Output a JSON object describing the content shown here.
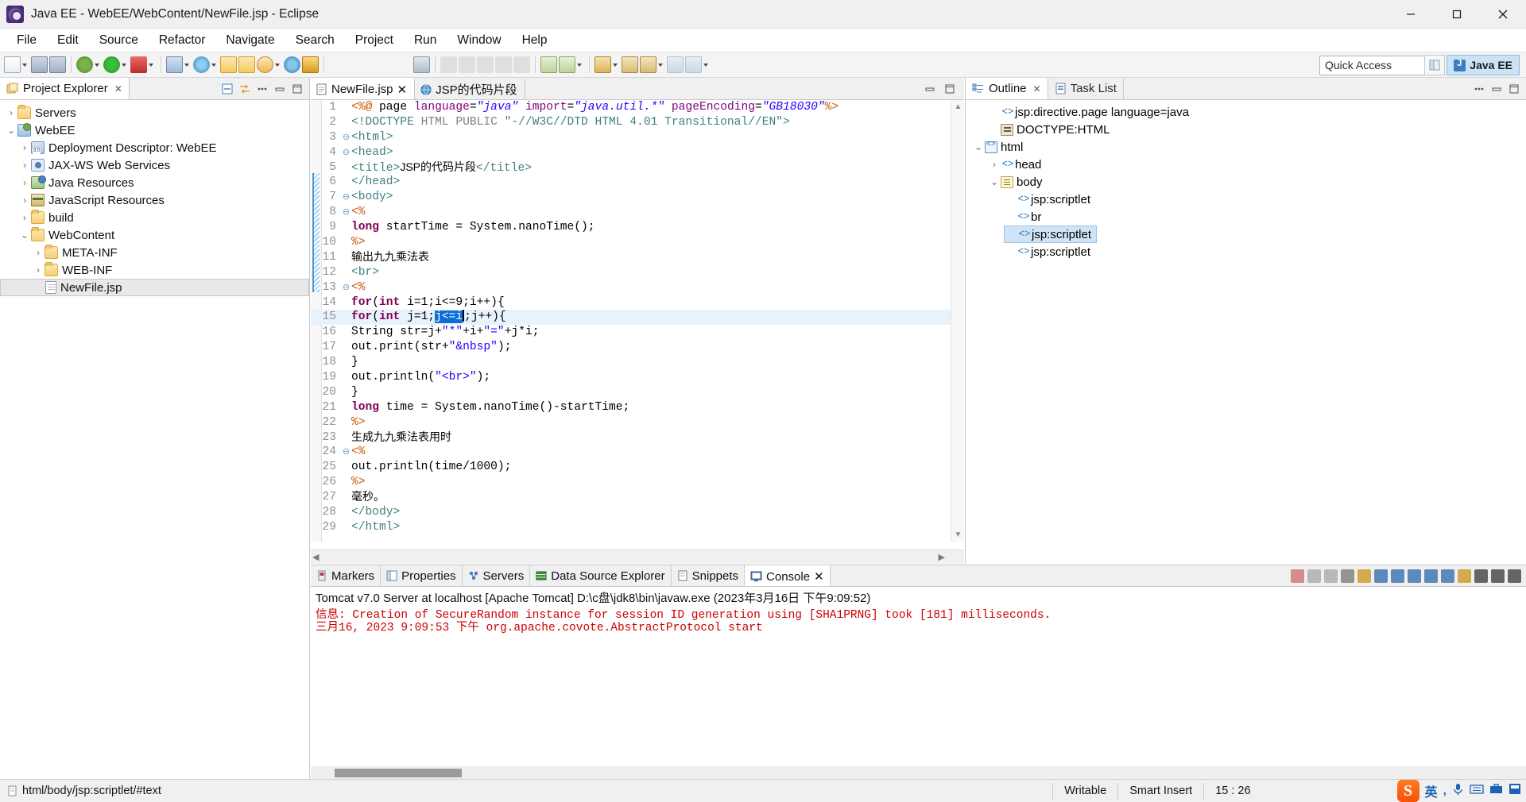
{
  "window": {
    "title": "Java EE - WebEE/WebContent/NewFile.jsp - Eclipse",
    "app_icon": "eclipse-icon",
    "minimize": "minimize-icon",
    "maximize": "maximize-icon",
    "close": "close-icon"
  },
  "menubar": {
    "items": [
      "File",
      "Edit",
      "Source",
      "Refactor",
      "Navigate",
      "Search",
      "Project",
      "Run",
      "Window",
      "Help"
    ]
  },
  "toolbar": {
    "quick_access_placeholder": "Quick Access",
    "perspective_label": "Java EE",
    "new_perspective_icon": "new-perspective-icon"
  },
  "project_explorer": {
    "tab_label": "Project Explorer",
    "tools": [
      "collapse-all-icon",
      "link-with-editor-icon",
      "view-menu-icon",
      "minimize-icon",
      "maximize-icon"
    ],
    "tree": [
      {
        "label": "Servers",
        "indent": 0,
        "twisty": ">",
        "icon": "folder-icon",
        "selected": false
      },
      {
        "label": "WebEE",
        "indent": 0,
        "twisty": "v",
        "icon": "project-icon",
        "selected": false
      },
      {
        "label": "Deployment Descriptor: WebEE",
        "indent": 1,
        "twisty": ">",
        "icon": "deployment-descriptor-icon",
        "selected": false
      },
      {
        "label": "JAX-WS Web Services",
        "indent": 1,
        "twisty": ">",
        "icon": "web-services-icon",
        "selected": false
      },
      {
        "label": "Java Resources",
        "indent": 1,
        "twisty": ">",
        "icon": "java-resources-icon",
        "selected": false
      },
      {
        "label": "JavaScript Resources",
        "indent": 1,
        "twisty": ">",
        "icon": "javascript-resources-icon",
        "selected": false
      },
      {
        "label": "build",
        "indent": 1,
        "twisty": ">",
        "icon": "folder-icon",
        "selected": false
      },
      {
        "label": "WebContent",
        "indent": 1,
        "twisty": "v",
        "icon": "folder-icon",
        "selected": false
      },
      {
        "label": "META-INF",
        "indent": 2,
        "twisty": ">",
        "icon": "folder-icon",
        "selected": false
      },
      {
        "label": "WEB-INF",
        "indent": 2,
        "twisty": ">",
        "icon": "folder-icon",
        "selected": false
      },
      {
        "label": "NewFile.jsp",
        "indent": 2,
        "twisty": "",
        "icon": "jsp-file-icon",
        "selected": true
      }
    ]
  },
  "editor": {
    "tabs": [
      {
        "label": "NewFile.jsp",
        "icon": "jsp-file-icon",
        "active": true,
        "closeable": true
      },
      {
        "label": "JSP的代码片段",
        "icon": "browser-icon",
        "active": false,
        "closeable": false
      }
    ],
    "minimize": "minimize-icon",
    "maximize": "maximize-icon",
    "selection_text": "j<=i",
    "highlighted_line": 15,
    "lines": [
      {
        "n": 1,
        "fold": "",
        "html": "<span class='k-dir'>&lt;%@</span> <span class='k-plain'>page </span><span class='k-attr'>language</span><span class='k-plain'>=</span><span class='k-str'>\"java\"</span> <span class='k-attr'>import</span><span class='k-plain'>=</span><span class='k-str'>\"java.util.*\"</span> <span class='k-attr'>pageEncoding</span><span class='k-plain'>=</span><span class='k-str'>\"GB18030\"</span><span class='k-dir'>%&gt;</span>"
      },
      {
        "n": 2,
        "fold": "",
        "html": "<span class='k-tag'>&lt;!DOCTYPE </span><span class='k-gray'>HTML PUBLIC </span><span class='k-tag'>\"-//W3C//DTD HTML 4.01 Transitional//EN\"&gt;</span>"
      },
      {
        "n": 3,
        "fold": "-",
        "html": "<span class='k-tag'>&lt;html&gt;</span>"
      },
      {
        "n": 4,
        "fold": "-",
        "html": "<span class='k-tag'>&lt;head&gt;</span>"
      },
      {
        "n": 5,
        "fold": "",
        "html": "<span class='k-tag'>&lt;title&gt;</span><span class='k-cn'>JSP的代码片段</span><span class='k-tag'>&lt;/title&gt;</span>"
      },
      {
        "n": 6,
        "fold": "",
        "html": "<span class='k-tag'>&lt;/head&gt;</span>"
      },
      {
        "n": 7,
        "fold": "-",
        "html": "<span class='k-tag'>&lt;body&gt;</span>"
      },
      {
        "n": 8,
        "fold": "-",
        "html": "    <span class='k-dir'>&lt;%</span>"
      },
      {
        "n": 9,
        "fold": "",
        "html": "        <span class='k-kw'>long</span> <span class='k-plain'>startTime = System.nanoTime();</span>"
      },
      {
        "n": 10,
        "fold": "",
        "html": "    <span class='k-dir'>%&gt;</span>"
      },
      {
        "n": 11,
        "fold": "",
        "html": "  <span class='k-cn'>输出九九乘法表</span>"
      },
      {
        "n": 12,
        "fold": "",
        "html": "    <span class='k-tag'>&lt;br&gt;</span>"
      },
      {
        "n": 13,
        "fold": "-",
        "html": "    <span class='k-dir'>&lt;%</span>"
      },
      {
        "n": 14,
        "fold": "",
        "html": "    <span class='k-kw'>for</span><span class='k-plain'>(</span><span class='k-kw'>int</span> <span class='k-plain'>i=1;i&lt;=9;i++){</span>"
      },
      {
        "n": 15,
        "fold": "",
        "html": "        <span class='k-kw'>for</span><span class='k-plain'>(</span><span class='k-kw'>int</span> <span class='k-plain'>j=1;</span><span class='sel'>j&lt;=i</span><span class='caret'></span><span class='k-plain'>;j++){</span>"
      },
      {
        "n": 16,
        "fold": "",
        "html": "            <span class='k-plain'>String str=j+</span><span class='k-str2'>\"*\"</span><span class='k-plain'>+i+</span><span class='k-str2'>\"=\"</span><span class='k-plain'>+j*i;</span>"
      },
      {
        "n": 17,
        "fold": "",
        "html": "            <span class='k-plain'>out.print(str+</span><span class='k-str2'>\"</span><span class='k-ent'>&amp;nbsp</span><span class='k-str2'>\"</span><span class='k-plain'>);</span>"
      },
      {
        "n": 18,
        "fold": "",
        "html": "        <span class='k-plain'>}</span>"
      },
      {
        "n": 19,
        "fold": "",
        "html": "        <span class='k-plain'>out.println(</span><span class='k-str2'>\"</span><span class='k-ent'>&lt;br&gt;</span><span class='k-str2'>\"</span><span class='k-plain'>);</span>"
      },
      {
        "n": 20,
        "fold": "",
        "html": "    <span class='k-plain'>}</span>"
      },
      {
        "n": 21,
        "fold": "",
        "html": "    <span class='k-kw'>long</span> <span class='k-plain'>time = System.nanoTime()-startTime;</span>"
      },
      {
        "n": 22,
        "fold": "",
        "html": "    <span class='k-dir'>%&gt;</span>"
      },
      {
        "n": 23,
        "fold": "",
        "html": "  <span class='k-cn'>生成九九乘法表用时</span>"
      },
      {
        "n": 24,
        "fold": "-",
        "html": "    <span class='k-dir'>&lt;%</span>"
      },
      {
        "n": 25,
        "fold": "",
        "html": "        <span class='k-plain'>out.println(time/1000);</span>"
      },
      {
        "n": 26,
        "fold": "",
        "html": "    <span class='k-dir'>%&gt;</span>"
      },
      {
        "n": 27,
        "fold": "",
        "html": "  <span class='k-cn'>毫秒。</span>"
      },
      {
        "n": 28,
        "fold": "",
        "html": "<span class='k-tag'>&lt;/body&gt;</span>"
      },
      {
        "n": 29,
        "fold": "",
        "html": "<span class='k-tag'>&lt;/html&gt;</span>"
      }
    ]
  },
  "outline": {
    "tabs": [
      {
        "label": "Outline",
        "icon": "outline-icon",
        "active": true,
        "closeable": true
      },
      {
        "label": "Task List",
        "icon": "tasklist-icon",
        "active": false,
        "closeable": false
      }
    ],
    "tools": [
      "view-menu-icon",
      "minimize-icon",
      "maximize-icon"
    ],
    "tree": [
      {
        "label": "jsp:directive.page language=java",
        "indent": 1,
        "twisty": "",
        "icon": "code-tag-icon",
        "selected": false
      },
      {
        "label": "DOCTYPE:HTML",
        "indent": 1,
        "twisty": "",
        "icon": "doctype-icon",
        "selected": false
      },
      {
        "label": "html",
        "indent": 0,
        "twisty": "v",
        "icon": "html-tag-icon",
        "selected": false
      },
      {
        "label": "head",
        "indent": 1,
        "twisty": ">",
        "icon": "code-tag-icon",
        "selected": false
      },
      {
        "label": "body",
        "indent": 1,
        "twisty": "v",
        "icon": "body-tag-icon",
        "selected": false
      },
      {
        "label": "jsp:scriptlet",
        "indent": 2,
        "twisty": "",
        "icon": "code-tag-icon",
        "selected": false
      },
      {
        "label": "br",
        "indent": 2,
        "twisty": "",
        "icon": "code-tag-icon",
        "selected": false
      },
      {
        "label": "jsp:scriptlet",
        "indent": 2,
        "twisty": "",
        "icon": "code-tag-icon",
        "selected": true
      },
      {
        "label": "jsp:scriptlet",
        "indent": 2,
        "twisty": "",
        "icon": "code-tag-icon",
        "selected": false
      }
    ]
  },
  "console": {
    "tabs": [
      {
        "label": "Markers",
        "icon": "markers-icon",
        "active": false,
        "closeable": false
      },
      {
        "label": "Properties",
        "icon": "properties-icon",
        "active": false,
        "closeable": false
      },
      {
        "label": "Servers",
        "icon": "servers-icon",
        "active": false,
        "closeable": false
      },
      {
        "label": "Data Source Explorer",
        "icon": "datasource-icon",
        "active": false,
        "closeable": false
      },
      {
        "label": "Snippets",
        "icon": "snippets-icon",
        "active": false,
        "closeable": false
      },
      {
        "label": "Console",
        "icon": "console-icon",
        "active": true,
        "closeable": true
      }
    ],
    "header": "Tomcat v7.0 Server at localhost [Apache Tomcat] D:\\c盘\\jdk8\\bin\\javaw.exe (2023年3月16日 下午9:09:52)",
    "lines": [
      "信息: Creation of SecureRandom instance for session ID generation using [SHA1PRNG] took [181] milliseconds.",
      "三月16, 2023 9:09:53 下午 org.apache.covote.AbstractProtocol start"
    ],
    "tools": [
      "terminate-icon",
      "remove-launch-icon",
      "remove-all-icon",
      "clear-console-icon",
      "scroll-lock-icon",
      "word-wrap-icon",
      "pin-console-icon",
      "display-console-icon",
      "open-console-icon",
      "console-menu-icon",
      "new-console-icon",
      "view-menu-icon",
      "minimize-icon",
      "maximize-icon"
    ]
  },
  "statusbar": {
    "path": "html/body/jsp:scriptlet/#text",
    "path_icon": "element-path-icon",
    "writable": "Writable",
    "insert_mode": "Smart Insert",
    "cursor_position": "15 : 26",
    "ime": {
      "logo": "sogou-logo-icon",
      "items": [
        "英",
        "chinese-punct-icon",
        "voice-input-icon",
        "soft-keyboard-icon",
        "toolbox-icon",
        "sogou-panel-icon"
      ]
    }
  },
  "colors": {
    "accent": "#0a6fd8",
    "highlight_line": "#e8f2fd",
    "selection_bg": "#0a6fd8",
    "console_text": "#cc0000",
    "outline_selected": "#cfe4f6",
    "perspective_active": "#cce3f6"
  }
}
